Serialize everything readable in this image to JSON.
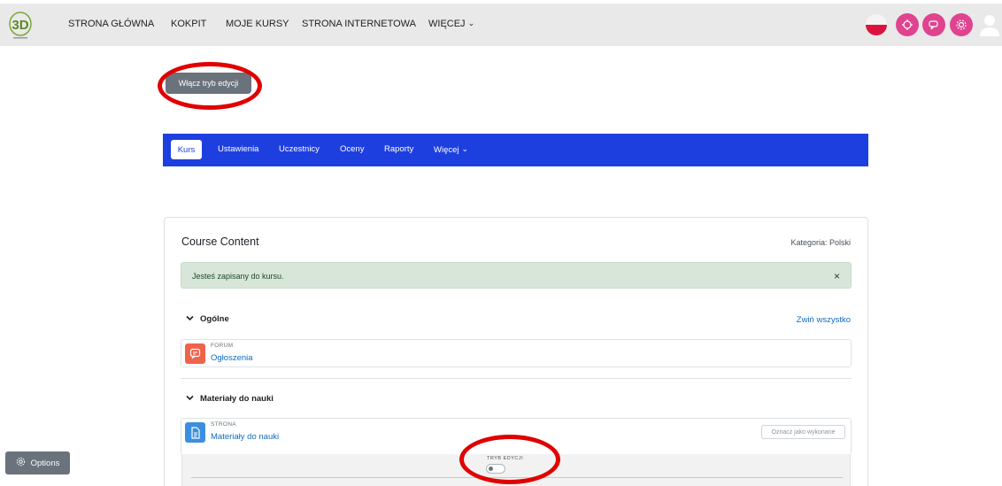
{
  "topnav": {
    "items": [
      {
        "label": "STRONA GŁÓWNA"
      },
      {
        "label": "KOKPIT"
      },
      {
        "label": "MOJE KURSY"
      },
      {
        "label": "STRONA INTERNETOWA"
      },
      {
        "label": "WIĘCEJ"
      }
    ],
    "icons": [
      "flag-pl-icon",
      "accessibility-icon",
      "chat-icon",
      "settings-icon",
      "user-icon"
    ],
    "accent_color": "#e0438f"
  },
  "edit_mode_button": {
    "label": "Włącz tryb edycji"
  },
  "course_nav": {
    "active": "Kurs",
    "items": [
      {
        "label": "Kurs"
      },
      {
        "label": "Ustawienia"
      },
      {
        "label": "Uczestnicy"
      },
      {
        "label": "Oceny"
      },
      {
        "label": "Raporty"
      },
      {
        "label": "Więcej"
      }
    ],
    "color": "#1e3fe0"
  },
  "course": {
    "title": "Course Content",
    "category": "Kategoria: Polski",
    "alert": {
      "text": "Jesteś zapisany do kursu.",
      "close": "×"
    },
    "collapse_all": "Zwiń wszystko",
    "sections": [
      {
        "title": "Ogólne",
        "activities": [
          {
            "type": "FORUM",
            "name": "Ogłoszenia",
            "icon": "forum-icon",
            "color": "#f0624a"
          }
        ]
      },
      {
        "title": "Materiały do nauki",
        "activities": [
          {
            "type": "STRONA",
            "name": "Materiały do nauki",
            "icon": "page-icon",
            "color": "#3b8fde",
            "mark_done": "Oznacz jako wykonane"
          }
        ]
      }
    ],
    "edit_toggle": {
      "label": "TRYB EDYCJI",
      "on": false
    }
  },
  "options_button": {
    "label": "Options"
  }
}
